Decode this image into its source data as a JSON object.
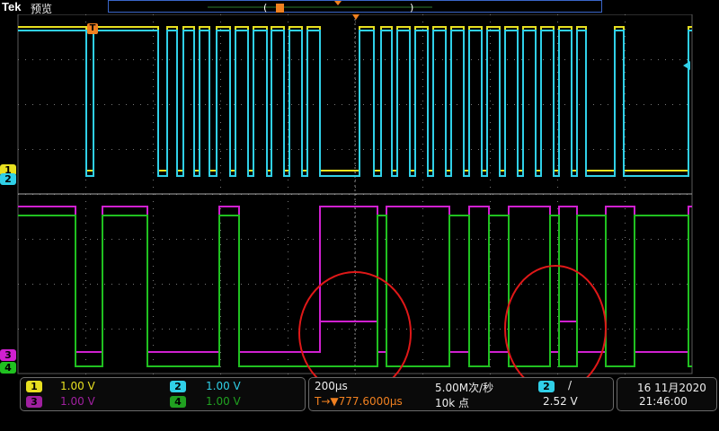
{
  "header": {
    "brand": "Tek",
    "mode": "预览"
  },
  "colors": {
    "ch1": "#e8e020",
    "ch2": "#30d0e8",
    "ch3": "#d020d0",
    "ch4": "#20c020",
    "trigger": "#f08020",
    "annotation": "#e01818",
    "grid": "#5a5a5a"
  },
  "channels": [
    {
      "id": "1",
      "scale": "1.00 V"
    },
    {
      "id": "2",
      "scale": "1.00 V"
    },
    {
      "id": "3",
      "scale": "1.00 V"
    },
    {
      "id": "4",
      "scale": "1.00 V"
    }
  ],
  "markers": {
    "trigger": "T",
    "ch1": "1",
    "ch2": "2",
    "ch3": "3",
    "ch4": "4"
  },
  "timebase": {
    "scale": "200µs",
    "sample_rate": "5.00M次/秒",
    "trigger_pos": "T→▼777.6000µs",
    "record_length": "10k 点"
  },
  "trigger": {
    "source": "2",
    "slope": "/",
    "level": "2.52 V"
  },
  "datetime": {
    "date": "16 11月2020",
    "time": "21:46:00"
  }
}
